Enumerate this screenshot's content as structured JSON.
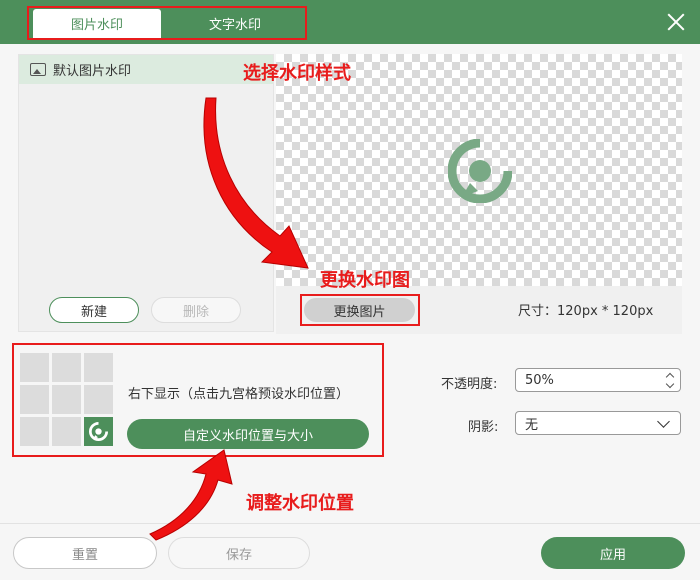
{
  "tabs": [
    {
      "label": "图片水印",
      "active": true
    },
    {
      "label": "文字水印",
      "active": false
    }
  ],
  "watermark_list": {
    "items": [
      {
        "label": "默认图片水印"
      }
    ]
  },
  "left_buttons": {
    "new_label": "新建",
    "delete_label": "删除"
  },
  "preview": {
    "replace_label": "更换图片",
    "size_text": "尺寸：120px * 120px"
  },
  "position": {
    "description": "右下显示（点击九宫格预设水印位置）",
    "custom_label": "自定义水印位置与大小",
    "selected_cell": 9
  },
  "settings": {
    "opacity_label": "不透明度:",
    "opacity_value": "50%",
    "shadow_label": "阴影:",
    "shadow_value": "无"
  },
  "footer": {
    "reset_label": "重置",
    "save_label": "保存",
    "apply_label": "应用"
  },
  "annotations": {
    "select_style": "选择水印样式",
    "replace_image": "更换水印图",
    "adjust_position": "调整水印位置"
  },
  "colors": {
    "accent": "#4d8f5b",
    "annotation": "#e81c1c"
  }
}
